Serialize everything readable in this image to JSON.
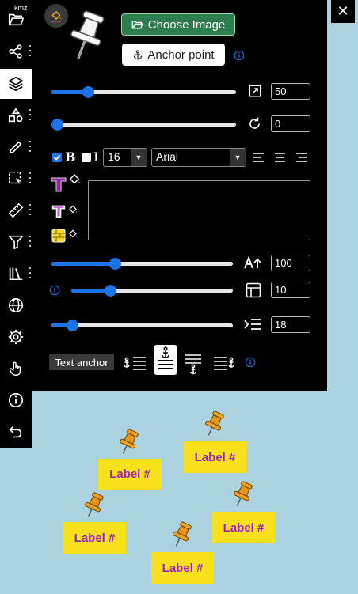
{
  "toolbar": {
    "kmz_label": "kmz",
    "items": [
      {
        "name": "open-folder",
        "dots": false
      },
      {
        "name": "share",
        "dots": true
      },
      {
        "name": "layers",
        "dots": false,
        "active": true
      },
      {
        "name": "shapes",
        "dots": true
      },
      {
        "name": "draw",
        "dots": true
      },
      {
        "name": "select",
        "dots": true
      },
      {
        "name": "measure",
        "dots": true
      },
      {
        "name": "filter",
        "dots": true
      },
      {
        "name": "library",
        "dots": true
      },
      {
        "name": "globe",
        "dots": false
      },
      {
        "name": "settings",
        "dots": false
      },
      {
        "name": "touch",
        "dots": false
      },
      {
        "name": "info",
        "dots": false
      },
      {
        "name": "undo",
        "dots": false
      }
    ]
  },
  "panel": {
    "close_symbol": "✕",
    "choose_image_label": "Choose Image",
    "anchor_point_label": "Anchor point",
    "scale": {
      "value": "50",
      "fraction": 0.18
    },
    "rotation": {
      "value": "0",
      "fraction": 0.0
    },
    "font": {
      "bold_checked": true,
      "bold_label": "B",
      "italic_checked": false,
      "italic_label": "I",
      "size": "16",
      "family": "Arial"
    },
    "label_text": "",
    "opacity": {
      "value": "100",
      "fraction": 0.34
    },
    "padding": {
      "value": "10",
      "fraction": 0.22
    },
    "indent": {
      "value": "18",
      "fraction": 0.09
    },
    "text_anchor_label": "Text anchor"
  },
  "map": {
    "labels": [
      "Label #",
      "Label #",
      "Label #",
      "Label #",
      "Label #"
    ],
    "colors": {
      "label_bg": "#f7e11a",
      "label_text": "#a020c0",
      "water": "#abd3df"
    }
  }
}
